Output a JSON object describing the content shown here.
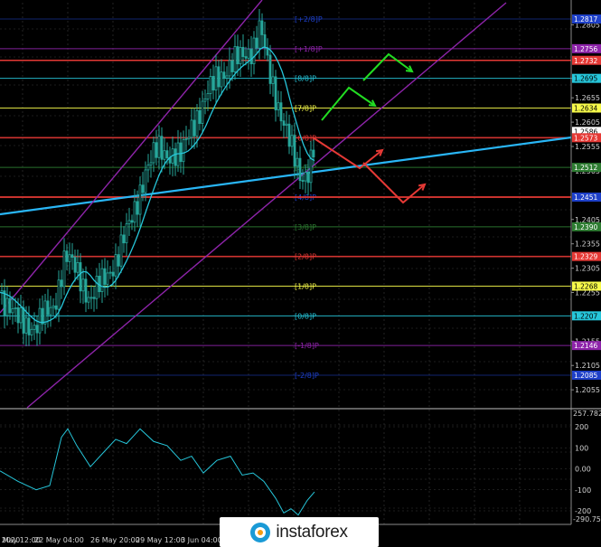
{
  "chart_data": [
    {
      "type": "line",
      "title": "",
      "price_axis_labels": [
        "1.2805",
        "1.2695",
        "1.2655",
        "1.2605",
        "1.2555",
        "1.2505",
        "1.2405",
        "1.2355",
        "1.2305",
        "1.2255",
        "1.2155",
        "1.2105",
        "1.2055"
      ],
      "price_tags": [
        {
          "label": "1.2756",
          "value": 1.2756,
          "bg": "#8e24aa",
          "fg": "#ffffff"
        },
        {
          "label": "1.2732",
          "value": 1.2732,
          "bg": "#e53935",
          "fg": "#ffffff"
        },
        {
          "label": "1.2695",
          "value": 1.2695,
          "bg": "#26c6da",
          "fg": "#000000"
        },
        {
          "label": "1.2634",
          "value": 1.2634,
          "bg": "#f6f94a",
          "fg": "#000000"
        },
        {
          "label": "1.2586",
          "value": 1.2586,
          "bg": "#ffffff",
          "fg": "#000000"
        },
        {
          "label": "1.2573",
          "value": 1.2573,
          "bg": "#e53935",
          "fg": "#ffffff"
        },
        {
          "label": "1.2512",
          "value": 1.2512,
          "bg": "#2e7d32",
          "fg": "#ffffff"
        },
        {
          "label": "1.2451",
          "value": 1.2451,
          "bg": "#1e40c8",
          "fg": "#ffffff"
        },
        {
          "label": "1.2390",
          "value": 1.239,
          "bg": "#2e7d32",
          "fg": "#ffffff"
        },
        {
          "label": "1.2329",
          "value": 1.2329,
          "bg": "#e53935",
          "fg": "#ffffff"
        },
        {
          "label": "1.2268",
          "value": 1.2268,
          "bg": "#f6f94a",
          "fg": "#000000"
        },
        {
          "label": "1.2207",
          "value": 1.2207,
          "bg": "#26c6da",
          "fg": "#000000"
        },
        {
          "label": "1.2146",
          "value": 1.2146,
          "bg": "#8e24aa",
          "fg": "#ffffff"
        },
        {
          "label": "1.2085",
          "value": 1.2085,
          "bg": "#1e40c8",
          "fg": "#ffffff"
        },
        {
          "label": "1.2817",
          "value": 1.2817,
          "bg": "#1e40c8",
          "fg": "#ffffff"
        }
      ],
      "murrey_levels": [
        {
          "label": "[+2/8]P",
          "value": 1.2817,
          "color": "#1e40c8",
          "dim": true
        },
        {
          "label": "[+1/8]P",
          "value": 1.2756,
          "color": "#8e24aa"
        },
        {
          "label": "[8/8]P",
          "value": 1.2695,
          "color": "#26c6da"
        },
        {
          "label": "[7/8]P",
          "value": 1.2634,
          "color": "#f6f94a"
        },
        {
          "label": "[6/8]P",
          "value": 1.2573,
          "color": "#e53935"
        },
        {
          "label": "[5/8]P",
          "value": 1.2512,
          "color": "#2e7d32"
        },
        {
          "label": "[4/8]P",
          "value": 1.2451,
          "color": "#1e40c8"
        },
        {
          "label": "[3/8]P",
          "value": 1.239,
          "color": "#2e7d32"
        },
        {
          "label": "[2/8]P",
          "value": 1.2329,
          "color": "#e53935"
        },
        {
          "label": "[1/8]P",
          "value": 1.2268,
          "color": "#f6f94a"
        },
        {
          "label": "[0/8]P",
          "value": 1.2207,
          "color": "#26c6da"
        },
        {
          "label": "[-1/8]P",
          "value": 1.2146,
          "color": "#8e24aa"
        },
        {
          "label": "[-2/8]P",
          "value": 1.2085,
          "color": "#1e40c8",
          "dim": true
        }
      ],
      "colors": {
        "background": "#000000",
        "grid": "#3a3a3a",
        "bull": "#26a69a",
        "bear": "#26a69a",
        "ma": "#26c6da",
        "regression": "#29b6f6",
        "channel": "#8e24aa",
        "red_level": "#e53935",
        "forecast_up": "#22dd22",
        "forecast_down": "#e53935"
      }
    },
    {
      "type": "line",
      "title": "",
      "indicator": "CCI",
      "header_value": "257.7826",
      "bottom_value": "-290.755",
      "axis_labels": [
        "200",
        "100",
        "0.00",
        "-100",
        "-200"
      ],
      "ylim": [
        -290.755,
        257.7826
      ],
      "x_labels": [
        "19 May 2020",
        "21 May 12:00",
        "22 May 04:00",
        "26 May 20:00",
        "29 May 12:00",
        "3 Jun 04:00",
        "5 Jun"
      ],
      "color": "#26c6da"
    }
  ],
  "watermark": {
    "brand": "instaforex",
    "icon": "instaforex-logo-icon"
  }
}
